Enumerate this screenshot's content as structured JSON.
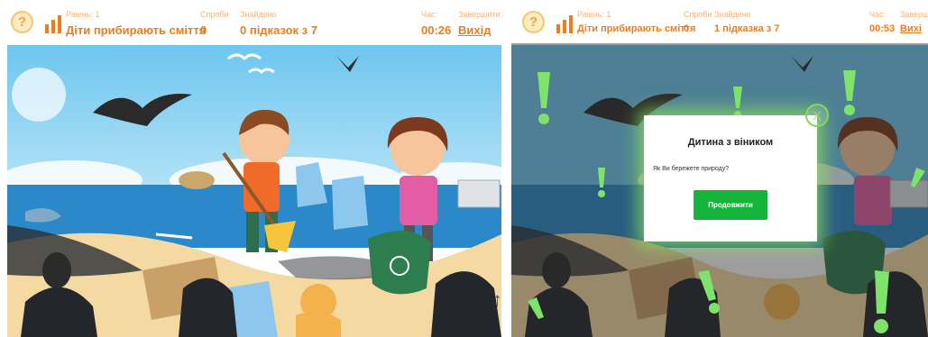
{
  "left": {
    "help_symbol": "?",
    "level_label": "Рівень: 1",
    "level_title": "Діти прибирають сміття",
    "attempts_label": "Спроби",
    "attempts_value": "0",
    "found_label": "Знайдено",
    "found_value": "0 підказок з 7",
    "time_label": "Час:",
    "time_value": "00:26",
    "finish_label": "Завершити:",
    "exit_label": "Вихід"
  },
  "right": {
    "help_symbol": "?",
    "level_label": "Рівень: 1",
    "level_title": "Діти прибирають сміття",
    "attempts_label": "Спроби",
    "attempts_value": "0",
    "found_label": "Знайдено",
    "found_value": "1 підказка з 7",
    "time_label": "Час:",
    "time_value": "00:53",
    "finish_label": "Заверш",
    "exit_label": "Вихі"
  },
  "modal": {
    "title": "Дитина з віником",
    "question": "Як Ви бережете природу?",
    "continue_label": "Продовжити",
    "close_symbol": "X"
  },
  "scroll_arrow": "↑",
  "colors": {
    "header_accent": "#ee7c1c",
    "button_green": "#15b53c",
    "hint_green": "#7ee36a"
  }
}
